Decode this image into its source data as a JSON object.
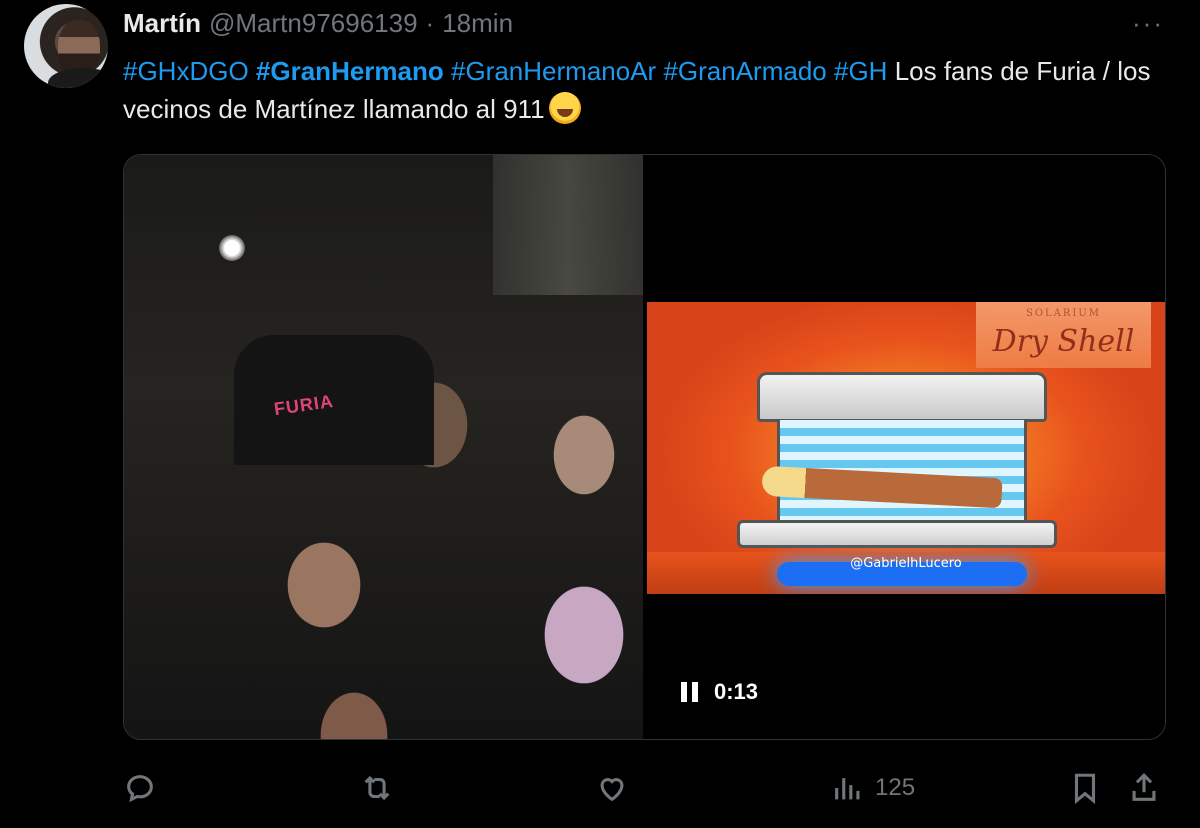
{
  "post": {
    "author_name": "Martín",
    "handle": "@Martn97696139",
    "separator": "·",
    "time": "18min",
    "more": "···",
    "hashtags": [
      "#GHxDGO",
      "#GranHermano",
      "#GranHermanoAr",
      "#GranArmado",
      "#GH"
    ],
    "text": "Los fans de Furia / los vecinos de Martínez llamando al 911"
  },
  "media": {
    "photo_shirt_text": "FURIA",
    "video": {
      "brand_small": "SOLARIUM",
      "brand": "Dry Shell",
      "credit": "@GabrielhLucero",
      "time": "0:13"
    }
  },
  "actions": {
    "views": "125"
  },
  "icons": [
    "reply-icon",
    "retweet-icon",
    "like-icon",
    "views-icon",
    "bookmark-icon",
    "share-icon",
    "pause-icon",
    "more-icon"
  ],
  "colors": {
    "background": "#000000",
    "text": "#e7e9ea",
    "muted": "#71767b",
    "link": "#1d9bf0"
  }
}
